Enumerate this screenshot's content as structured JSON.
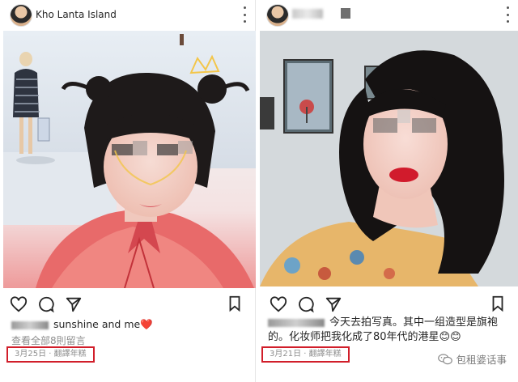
{
  "left_post": {
    "location": "Kho Lanta Island",
    "caption_text": "sunshine and me",
    "caption_emoji": "❤️",
    "comments_link": "查看全部8則留言",
    "date_text": "3月25日 · 翻譯年糕"
  },
  "right_post": {
    "caption_line1": "今天去拍写真。其中一组造型是旗袍",
    "caption_line2": "的。化妆师把我化成了80年代的港星😊😊",
    "date_text": "3月21日 · 翻譯年糕"
  },
  "watermark": {
    "text": "包租婆话事"
  },
  "icons": [
    "more-options-icon",
    "heart-icon",
    "comment-icon",
    "share-icon",
    "bookmark-icon",
    "wechat-icon"
  ]
}
